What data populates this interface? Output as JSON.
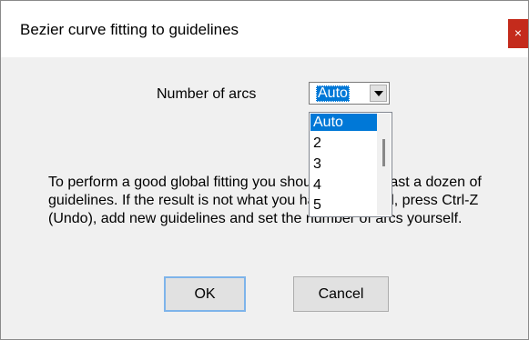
{
  "window": {
    "title": "Bezier curve fitting to guidelines",
    "close_glyph": "×"
  },
  "arcs": {
    "label": "Number of arcs",
    "selected_value": "Auto",
    "options": [
      "Auto",
      "2",
      "3",
      "4",
      "5"
    ]
  },
  "description": "To perform a good global fitting you should have at least a dozen of guidelines. If the result is not what you have expected, press Ctrl-Z (Undo),  add new guidelines and set the number of arcs yourself.",
  "buttons": {
    "ok": "OK",
    "cancel": "Cancel"
  },
  "colors": {
    "accent": "#0078d7",
    "close": "#c42b1c"
  }
}
